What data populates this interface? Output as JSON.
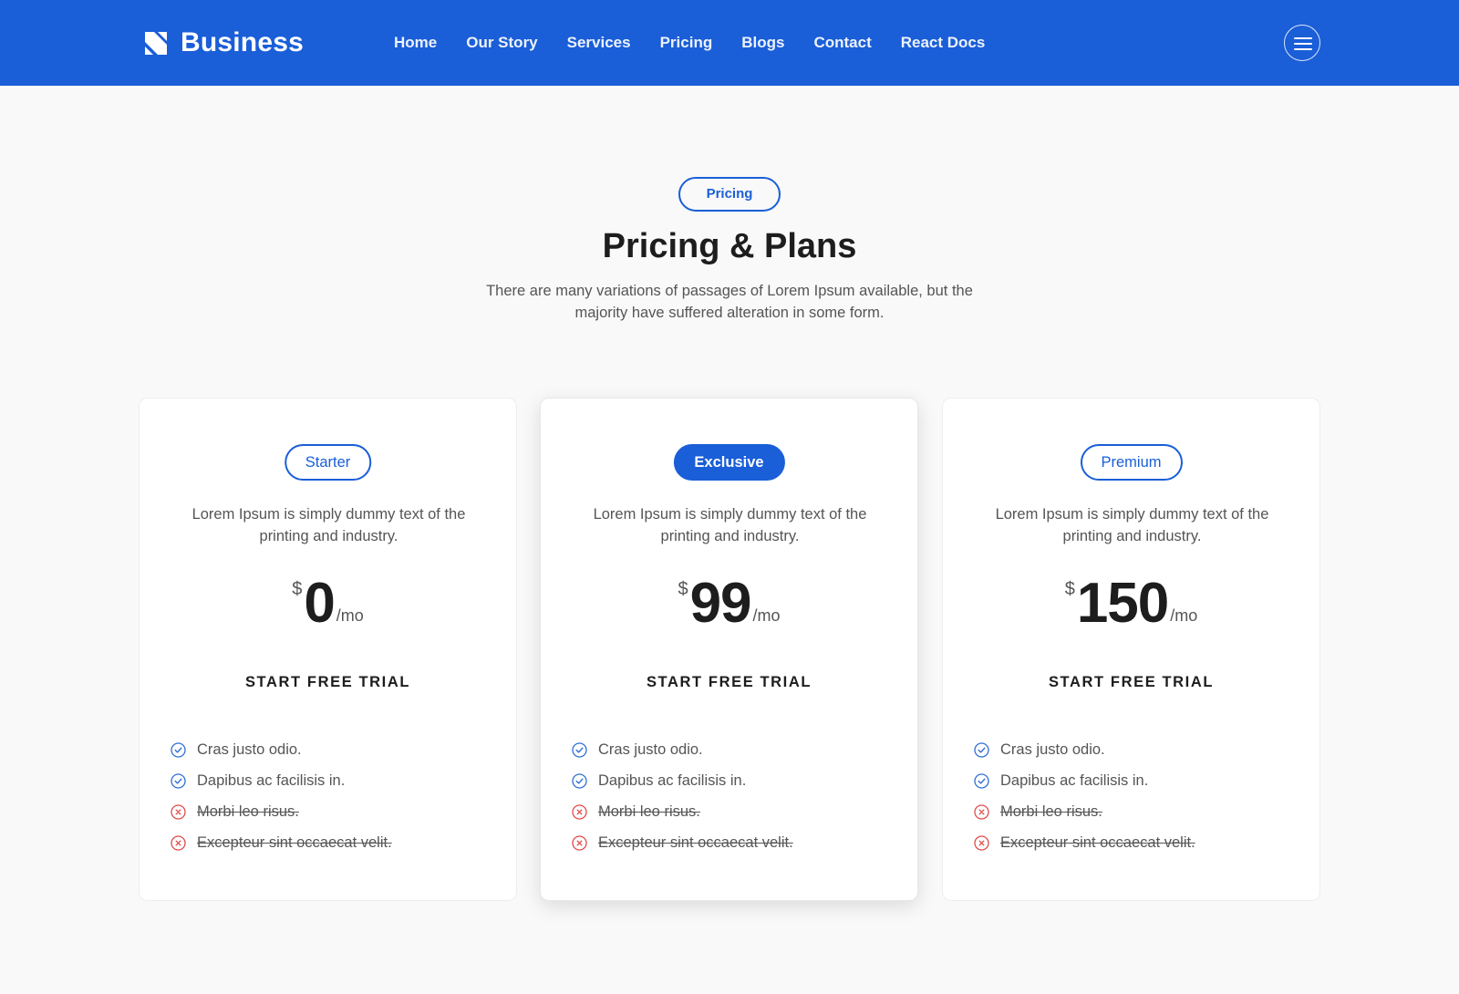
{
  "navbar": {
    "brand": "Business",
    "items": [
      {
        "label": "Home"
      },
      {
        "label": "Our Story"
      },
      {
        "label": "Services"
      },
      {
        "label": "Pricing"
      },
      {
        "label": "Blogs"
      },
      {
        "label": "Contact"
      },
      {
        "label": "React Docs"
      }
    ]
  },
  "section": {
    "tag": "Pricing",
    "title": "Pricing & Plans",
    "subtitle": "There are many variations of passages of Lorem Ipsum available, but the majority have suffered alteration in some form."
  },
  "plans": [
    {
      "name": "Starter",
      "description": "Lorem Ipsum is simply dummy text of the printing and industry.",
      "currency": "$",
      "amount": "0",
      "period": "/mo",
      "cta": "START FREE TRIAL",
      "features": [
        {
          "text": "Cras justo odio.",
          "included": true
        },
        {
          "text": "Dapibus ac facilisis in.",
          "included": true
        },
        {
          "text": "Morbi leo risus.",
          "included": false
        },
        {
          "text": "Excepteur sint occaecat velit.",
          "included": false
        }
      ]
    },
    {
      "name": "Exclusive",
      "description": "Lorem Ipsum is simply dummy text of the printing and industry.",
      "currency": "$",
      "amount": "99",
      "period": "/mo",
      "cta": "START FREE TRIAL",
      "features": [
        {
          "text": "Cras justo odio.",
          "included": true
        },
        {
          "text": "Dapibus ac facilisis in.",
          "included": true
        },
        {
          "text": "Morbi leo risus.",
          "included": false
        },
        {
          "text": "Excepteur sint occaecat velit.",
          "included": false
        }
      ]
    },
    {
      "name": "Premium",
      "description": "Lorem Ipsum is simply dummy text of the printing and industry.",
      "currency": "$",
      "amount": "150",
      "period": "/mo",
      "cta": "START FREE TRIAL",
      "features": [
        {
          "text": "Cras justo odio.",
          "included": true
        },
        {
          "text": "Dapibus ac facilisis in.",
          "included": true
        },
        {
          "text": "Morbi leo risus.",
          "included": false
        },
        {
          "text": "Excepteur sint occaecat velit.",
          "included": false
        }
      ]
    }
  ],
  "colors": {
    "primary": "#1a5ed8",
    "check": "#2f6fd6",
    "cross": "#e04a4a",
    "text_muted": "#555555",
    "heading": "#1d1d1d"
  },
  "icons": {
    "brand": "logo-icon",
    "menu": "hamburger-icon",
    "included": "check-circle-icon",
    "excluded": "x-circle-icon"
  }
}
